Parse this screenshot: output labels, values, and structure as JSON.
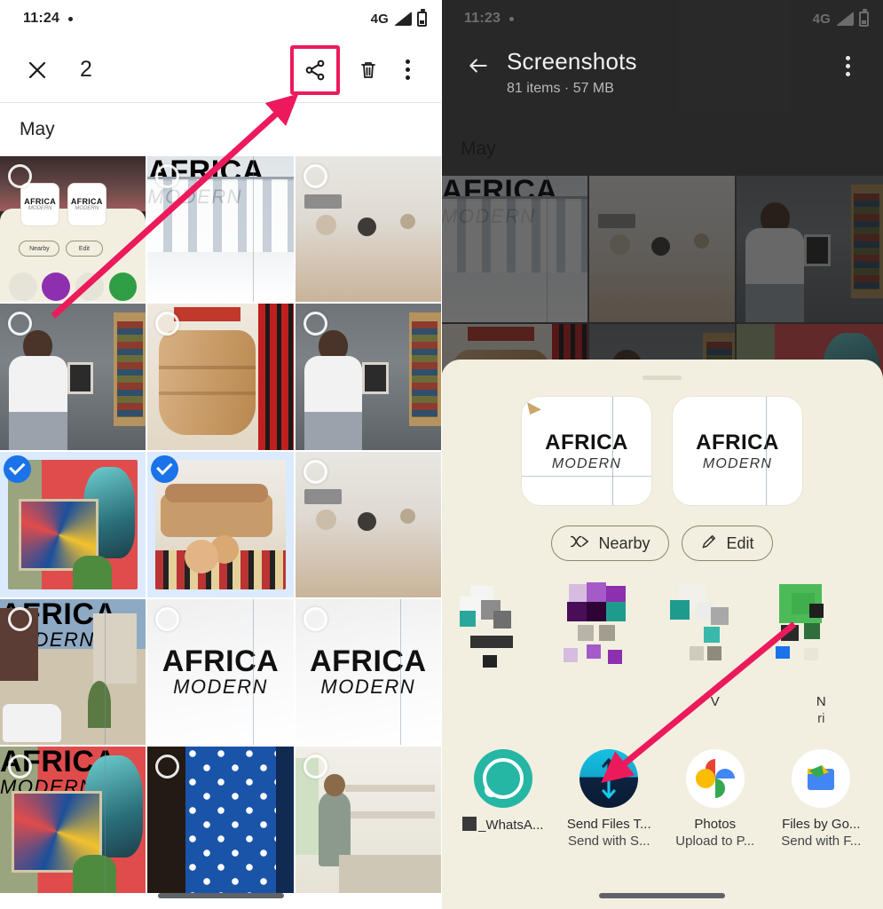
{
  "left_panel": {
    "status_bar": {
      "time": "11:24",
      "network": "4G",
      "dot": "•"
    },
    "app_bar": {
      "close_label": "✕",
      "selection_count": "2",
      "share_icon": "share-icon",
      "delete_icon": "trash-icon",
      "more_icon": "overflow-menu-icon"
    },
    "date_header": "May",
    "grid": [
      [
        {
          "name": "share-sheet-screenshot",
          "art": "art-sheetshot",
          "selected": false,
          "inner": {
            "title": "AFRICA",
            "subtitle": "MODERN",
            "nearby": "Nearby",
            "edit": "Edit"
          }
        },
        {
          "name": "africa-modern-clothes-rail",
          "art": "art-clothes",
          "selected": false,
          "caption1": "AFRICA",
          "caption2": "MODERN"
        },
        {
          "name": "living-room-interior",
          "art": "art-livingroom",
          "selected": false
        }
      ],
      [
        {
          "name": "man-seated-portrait",
          "art": "art-portrait",
          "selected": false
        },
        {
          "name": "wooden-pot-closeup",
          "art": "art-pot",
          "selected": false
        },
        {
          "name": "man-seated-portrait-2",
          "art": "art-portrait",
          "selected": false
        }
      ],
      [
        {
          "name": "mural-artwork",
          "art": "art-mural",
          "selected": true
        },
        {
          "name": "couch-and-bowls",
          "art": "art-couch",
          "selected": true
        },
        {
          "name": "living-room-interior-2",
          "art": "art-livingroom",
          "selected": false
        }
      ],
      [
        {
          "name": "africa-modern-street",
          "art": "art-street",
          "selected": false,
          "caption1": "AFRICA",
          "caption2": "MODERN"
        },
        {
          "name": "africa-modern-plain",
          "art": "art-africa",
          "selected": false,
          "caption1": "AFRICA",
          "caption2": "MODERN"
        },
        {
          "name": "africa-modern-plain-2",
          "art": "art-africa",
          "selected": false,
          "caption1": "AFRICA",
          "caption2": "MODERN"
        }
      ],
      [
        {
          "name": "africa-modern-painting",
          "art": "art-mural",
          "selected": false,
          "caption1": "AFRICA",
          "caption2": "MODERN"
        },
        {
          "name": "blue-patterned-fabric",
          "art": "art-fabric",
          "selected": false
        },
        {
          "name": "woman-in-shop",
          "art": "art-shop",
          "selected": false
        }
      ]
    ]
  },
  "right_panel": {
    "status_bar": {
      "time": "11:23",
      "network": "4G",
      "dot": "•"
    },
    "app_bar": {
      "back_icon": "back-arrow-icon",
      "title": "Screenshots",
      "subtitle": "81 items · 57 MB",
      "more_icon": "overflow-menu-icon"
    },
    "date_header": "May",
    "share_sheet": {
      "previews": [
        {
          "title": "AFRICA",
          "subtitle": "MODERN"
        },
        {
          "title": "AFRICA",
          "subtitle": "MODERN"
        }
      ],
      "chips": [
        {
          "label": "Nearby",
          "icon": "nearby-share-icon"
        },
        {
          "label": "Edit",
          "icon": "pencil-icon"
        }
      ],
      "app_rows": [
        [
          {
            "name": "censored-contact-1",
            "line1": "",
            "line2": "",
            "censored": true
          },
          {
            "name": "censored-contact-2",
            "line1": "",
            "line2": "",
            "censored": true
          },
          {
            "name": "censored-contact-3",
            "line1": "V",
            "line2": "",
            "censored": true
          },
          {
            "name": "censored-contact-4",
            "line1": "N",
            "line2": "ri",
            "censored": true
          }
        ],
        [
          {
            "name": "whatsapp",
            "line1": "_WhatsA...",
            "line2": "",
            "icon": "whatsapp-icon"
          },
          {
            "name": "send-files-to-tv",
            "line1": "Send Files T...",
            "line2": "Send with S...",
            "icon": "send-files-icon",
            "highlighted": true
          },
          {
            "name": "google-photos",
            "line1": "Photos",
            "line2": "Upload to P...",
            "icon": "google-photos-icon"
          },
          {
            "name": "files-by-google",
            "line1": "Files by Go...",
            "line2": "Send with F...",
            "icon": "files-by-google-icon"
          }
        ]
      ]
    }
  },
  "annotations": {
    "highlight_color": "#ec1a5c",
    "arrow_left": {
      "from": "grid-thumbnail-area",
      "to": "share-button"
    },
    "arrow_right": {
      "from": "app-row-upper",
      "to": "send-files-to-tv-app"
    }
  }
}
